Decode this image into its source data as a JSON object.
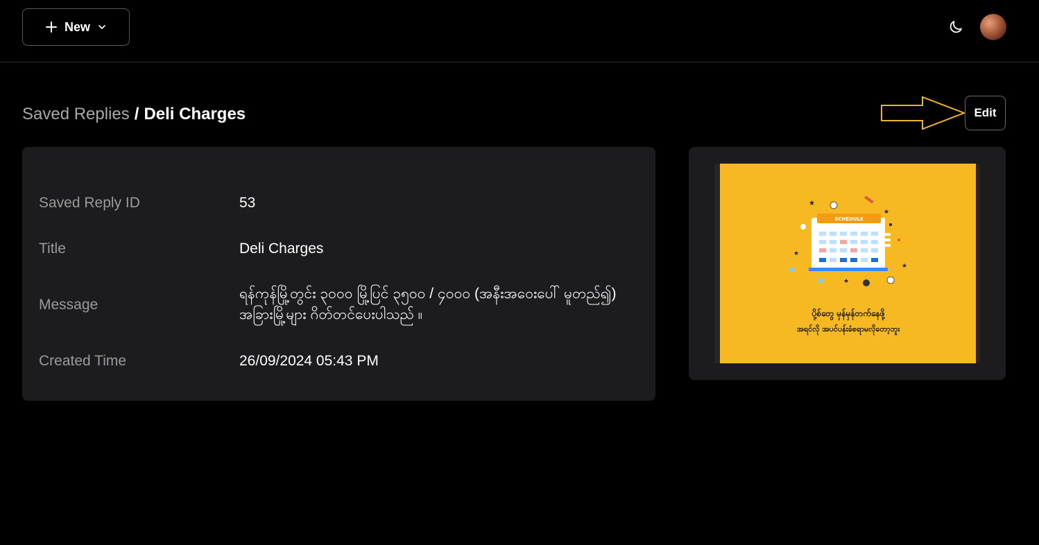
{
  "topbar": {
    "new_label": "New"
  },
  "breadcrumb": {
    "parent": "Saved Replies",
    "separator": "/",
    "current": "Deli Charges"
  },
  "actions": {
    "edit_label": "Edit"
  },
  "details": {
    "rows": [
      {
        "label": "Saved Reply ID",
        "value": "53"
      },
      {
        "label": "Title",
        "value": "Deli Charges"
      },
      {
        "label": "Message",
        "value": "ရန်ကုန်မြို့တွင်း ၃၀၀၀ မြို့ပြင် ၃၅၀၀ / ၄၀၀၀ (အနီးအဝေးပေါ် မူတည်၍) အခြားမြို့များ ဂိတ်တင်ပေးပါသည် ။"
      },
      {
        "label": "Created Time",
        "value": "26/09/2024 05:43 PM"
      }
    ]
  },
  "attachment": {
    "banner_label": "SCHEDULE",
    "caption_line1": "ပို့စ်တွေ မှန်မှန်တက်နေဖို့",
    "caption_line2": "အရင်လို အပင်ပန်းခံစရာမလိုတော့ဘူး"
  },
  "colors": {
    "background": "#000000",
    "card": "#1c1c1e",
    "muted_text": "#9a9a9a",
    "annotation_arrow": "#f0b429",
    "image_bg": "#f6b921"
  },
  "icons": {
    "new": "plus-icon",
    "new_menu": "chevron-down-icon",
    "theme": "moon-icon",
    "annotation": "arrow-right-icon"
  }
}
